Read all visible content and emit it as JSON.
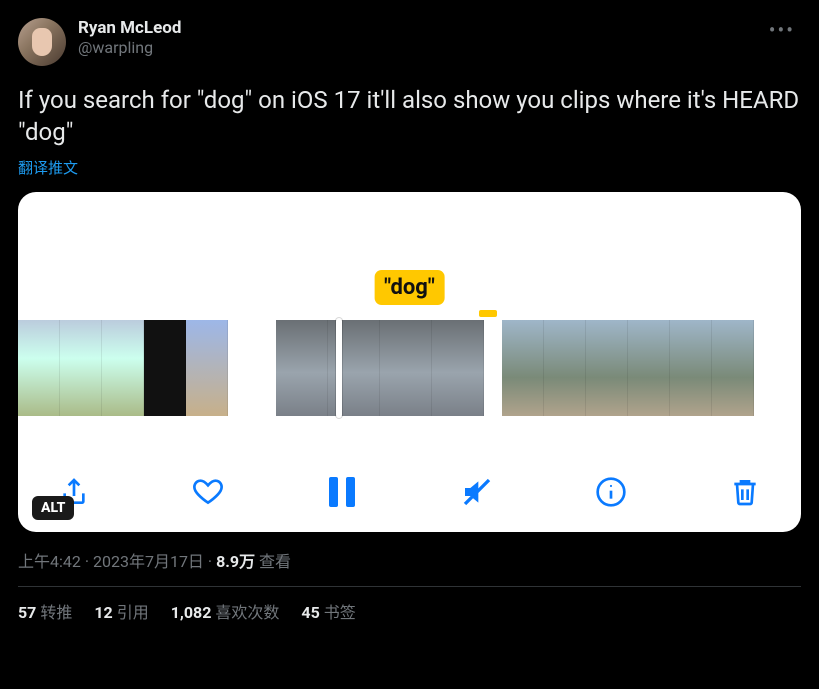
{
  "author": {
    "display_name": "Ryan McLeod",
    "handle": "@warpling"
  },
  "text": "If you search for \"dog\" on iOS 17 it'll also show you clips where it's HEARD \"dog\"",
  "translate_label": "翻译推文",
  "media": {
    "search_tag": "\"dog\"",
    "alt_badge": "ALT"
  },
  "timestamp": {
    "time": "上午4:42",
    "date": "2023年7月17日",
    "views_count": "8.9万",
    "views_label": "查看"
  },
  "stats": {
    "retweets_count": "57",
    "retweets_label": "转推",
    "quotes_count": "12",
    "quotes_label": "引用",
    "likes_count": "1,082",
    "likes_label": "喜欢次数",
    "bookmarks_count": "45",
    "bookmarks_label": "书签"
  }
}
